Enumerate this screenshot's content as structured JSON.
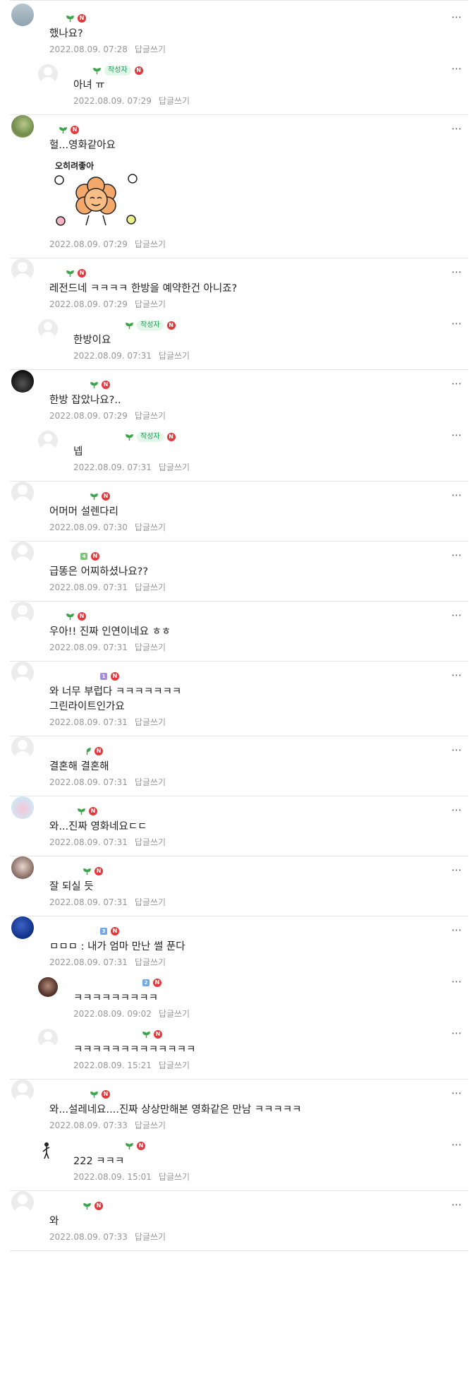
{
  "reply_label": "답글쓰기",
  "comments": [
    {
      "text": "했나요?",
      "date": "2022.08.09. 07:28",
      "replies": [
        {
          "text": "아녀 ㅠ",
          "date": "2022.08.09. 07:29",
          "writer": "작성자"
        }
      ]
    },
    {
      "text": "헐...영화같아요",
      "date": "2022.08.09. 07:29",
      "sticker_text": "오히려좋아",
      "replies": []
    },
    {
      "text": "레전드네 ㅋㅋㅋㅋ 한방을 예약한건 아니죠?",
      "date": "2022.08.09. 07:29",
      "replies": [
        {
          "text": "한방이요",
          "date": "2022.08.09. 07:31",
          "writer": "작성자"
        }
      ]
    },
    {
      "text": "한방 잡았나요?..",
      "date": "2022.08.09. 07:29",
      "replies": [
        {
          "text": "넵",
          "date": "2022.08.09. 07:31",
          "writer": "작성자"
        }
      ]
    },
    {
      "text": "어머머 설렌다리",
      "date": "2022.08.09. 07:30",
      "replies": []
    },
    {
      "text": "급똥은 어찌하셨나요??",
      "date": "2022.08.09. 07:31",
      "replies": []
    },
    {
      "text": "우아!! 진짜 인연이네요 ㅎㅎ",
      "date": "2022.08.09. 07:31",
      "replies": []
    },
    {
      "text": "와 너무 부럽다 ㅋㅋㅋㅋㅋㅋㅋ\n그린라이트인가요",
      "date": "2022.08.09. 07:31",
      "replies": []
    },
    {
      "text": "결혼해 결혼해",
      "date": "2022.08.09. 07:31",
      "replies": []
    },
    {
      "text": "와...진짜 영화네요ㄷㄷ",
      "date": "2022.08.09. 07:31",
      "replies": []
    },
    {
      "text": "잘 되실 듯",
      "date": "2022.08.09. 07:31",
      "replies": []
    },
    {
      "text": "ㅁㅁㅁ : 내가 엄마 만난 썰 푼다",
      "date": "2022.08.09. 07:31",
      "replies": [
        {
          "text": "ㅋㅋㅋㅋㅋㅋㅋㅋㅋ",
          "date": "2022.08.09. 09:02"
        },
        {
          "text": "ㅋㅋㅋㅋㅋㅋㅋㅋㅋㅋㅋㅋㅋ",
          "date": "2022.08.09. 15:21"
        }
      ]
    },
    {
      "text": "와...설레네요....진짜 상상만해본 영화같은 만남 ㅋㅋㅋㅋㅋ",
      "date": "2022.08.09. 07:33",
      "replies": [
        {
          "text": "222 ㅋㅋㅋ",
          "date": "2022.08.09. 15:01"
        }
      ]
    },
    {
      "text": "와",
      "date": "2022.08.09. 07:33",
      "replies": []
    }
  ],
  "colors": {
    "new_badge": "#e5383b",
    "writer_badge": "#1b9e55",
    "meta_gray": "#979797"
  }
}
